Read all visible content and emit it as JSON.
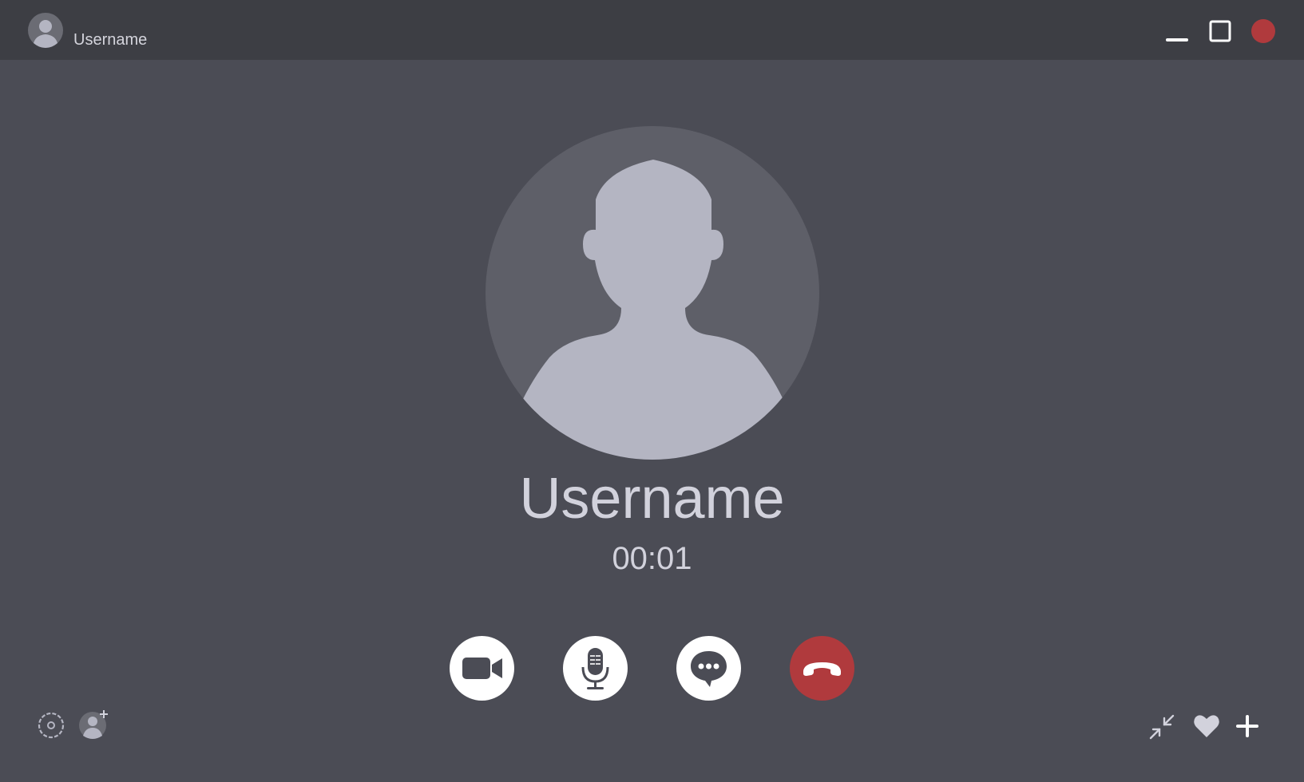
{
  "window": {
    "title": "Username",
    "controls": {
      "minimize_icon": "minimize-icon",
      "maximize_icon": "maximize-icon",
      "close_icon": "close-icon"
    }
  },
  "caller": {
    "name": "Username",
    "timer": "00:01",
    "avatar_icon": "user-silhouette-icon"
  },
  "call_controls": [
    {
      "icon": "video-camera-icon",
      "color": "#ffffff"
    },
    {
      "icon": "microphone-icon",
      "color": "#ffffff"
    },
    {
      "icon": "chat-bubble-icon",
      "color": "#ffffff"
    },
    {
      "icon": "hang-up-phone-icon",
      "color": "#b03a3d"
    }
  ],
  "bottom_left_tools": [
    "settings-icon",
    "add-user-icon"
  ],
  "bottom_right_tools": [
    "minimize-window-icon",
    "heart-icon",
    "plus-icon"
  ],
  "colors": {
    "background": "#4b4c55",
    "titlebar": "#3d3e44",
    "accent_red": "#b03a3d",
    "avatar_circle": "#5e5f68",
    "silhouette": "#b4b5c2",
    "text": "#d2d2dc"
  }
}
